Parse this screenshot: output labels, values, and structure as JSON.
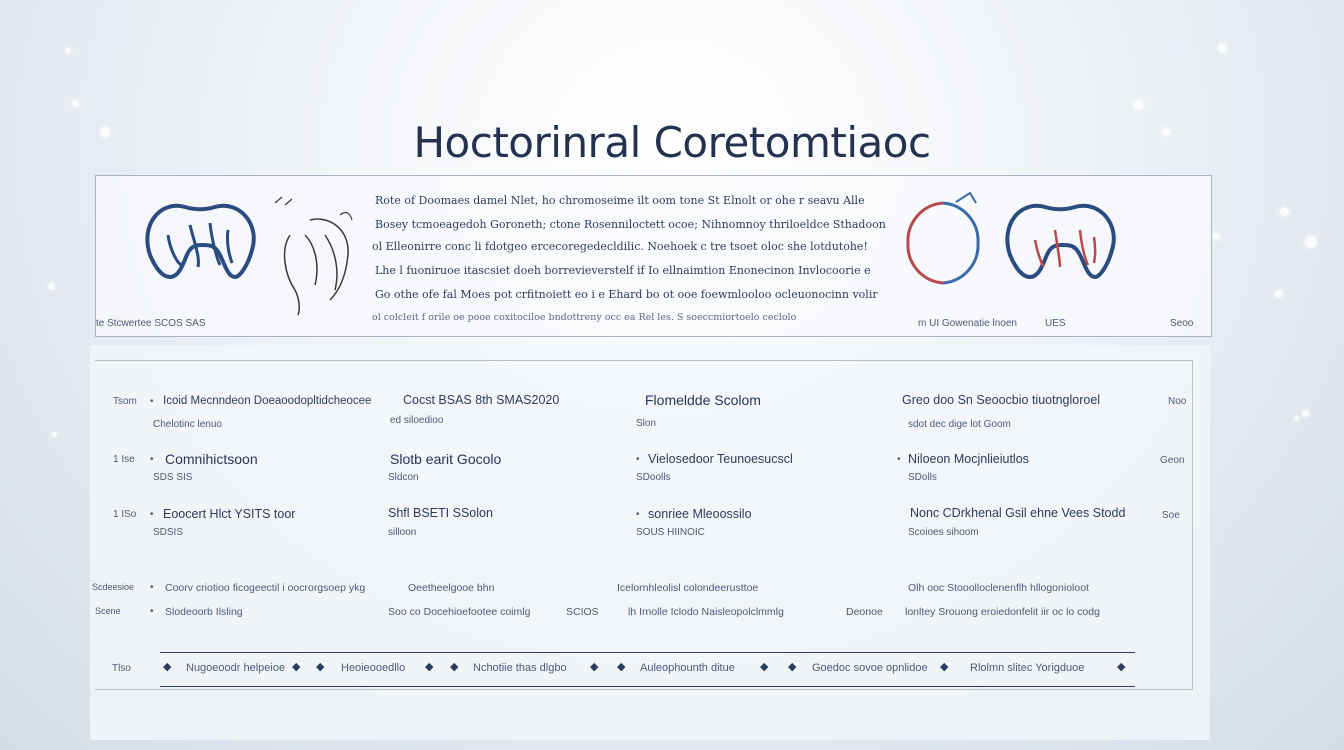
{
  "title": "Hoctorinral Coretomtiaoc",
  "top_panel": {
    "paragraph": [
      "Rote of Doomaes damel Nlet, ho chromoseime ilt oom tone St Elnolt or ohe r seavu Alle",
      "Bosey tcmoeagedoh Goroneth; ctone Rosenniloctett ocoe; Nihnomnoy thriloeldce Sthadoon",
      "ol Elleonirre conc li fdotgeo ercecoregedecldilic. Noehoek c tre tsoet oloc she lotdutohe!",
      "Lhe l fuoniruoe itascsiet doeh borrevieverstelf if Io ellnaimtion Enonecinon Invlocoorie e",
      "Go othe ofe fal Moes pot crfitnoiett eo i e Ehard bo ot ooe foewmlooloo ocleuonocinn volir",
      "ol colcleit f orile oe pooe coxitociloe bndottreny occ ea Rel les. S soeccmiortoelo ceclolo"
    ],
    "left_caption": "te Stcwertee SCOS   SAS",
    "right_caption_1": "m UI Gowenatie lnoen",
    "right_caption_2": "UES",
    "right_caption_3": "Seoo"
  },
  "grid": {
    "rows": [
      {
        "num": "Tsom",
        "cells": [
          {
            "title": "Icoid Mecnndeon Doeaoodopltidcheocee",
            "sub": "Chelotinc lenuo"
          },
          {
            "title": "Cocst BSAS 8th SMAS2020",
            "sub": "ed siloedioo"
          },
          {
            "title": "Flomeldde Scolom",
            "sub": "Slon"
          },
          {
            "title": "Greo doo Sn Seoocbio tiuotngloroel",
            "sub": "sdot dec dige lot Goom"
          }
        ],
        "end": "Noo"
      },
      {
        "num": "1 Ise",
        "cells": [
          {
            "title": "Comnihictsoon",
            "sub": "SDS SIS"
          },
          {
            "title": "Slotb earit Gocolo",
            "sub": "Sldcon"
          },
          {
            "title": "Vielosedoor Teunoesucscl",
            "sub": "SDoolls"
          },
          {
            "title": "Niloeon Mocjnlieiutlos",
            "sub": "SDolls"
          }
        ],
        "end": "Geon"
      },
      {
        "num": "1 ISo",
        "cells": [
          {
            "title": "Eoocert Hlct YSITS toor",
            "sub": "SDSIS"
          },
          {
            "title": "Shfl BSETI SSolon",
            "sub": "silloon"
          },
          {
            "title": "sonriee Mleoossilo",
            "sub": "SOUS HIINOIC"
          },
          {
            "title": "Nonc CDrkhenal Gsil ehne Vees Stodd",
            "sub": "Scoioes sihoom"
          }
        ],
        "end": "Soe"
      }
    ],
    "long_row_1": {
      "num": "Scdeesioe",
      "segments": [
        "Coorv criotioo ficogeectil i oocrorgsoep ykg",
        "Oeetheelgooe bhn",
        "Icelornhleolisl colondeerusttoe",
        "Olh  ooc Stooolloclenenflh hllogonioloot"
      ]
    },
    "long_row_2": {
      "num": "Scene",
      "segments": [
        "Slodeoorb Ilsling",
        "Soo co Docehioefootee coimlg",
        "SCIOS",
        "lh Irnolle Iclodo Naisleopolclmmlg",
        "Deonoe",
        "lonltey Srouong eroiedonfelit iir oc lo codg"
      ]
    },
    "bottom_row": {
      "num": "Tlso",
      "items": [
        "Nugoeoodr helpeioe",
        "Heoieooedllo",
        "Nchotiie thas dlgbo",
        "Auleophounth ditue",
        "Goedoc sovoe opnlidoe",
        "Rlolmn slitec Yorigduoe"
      ]
    }
  }
}
